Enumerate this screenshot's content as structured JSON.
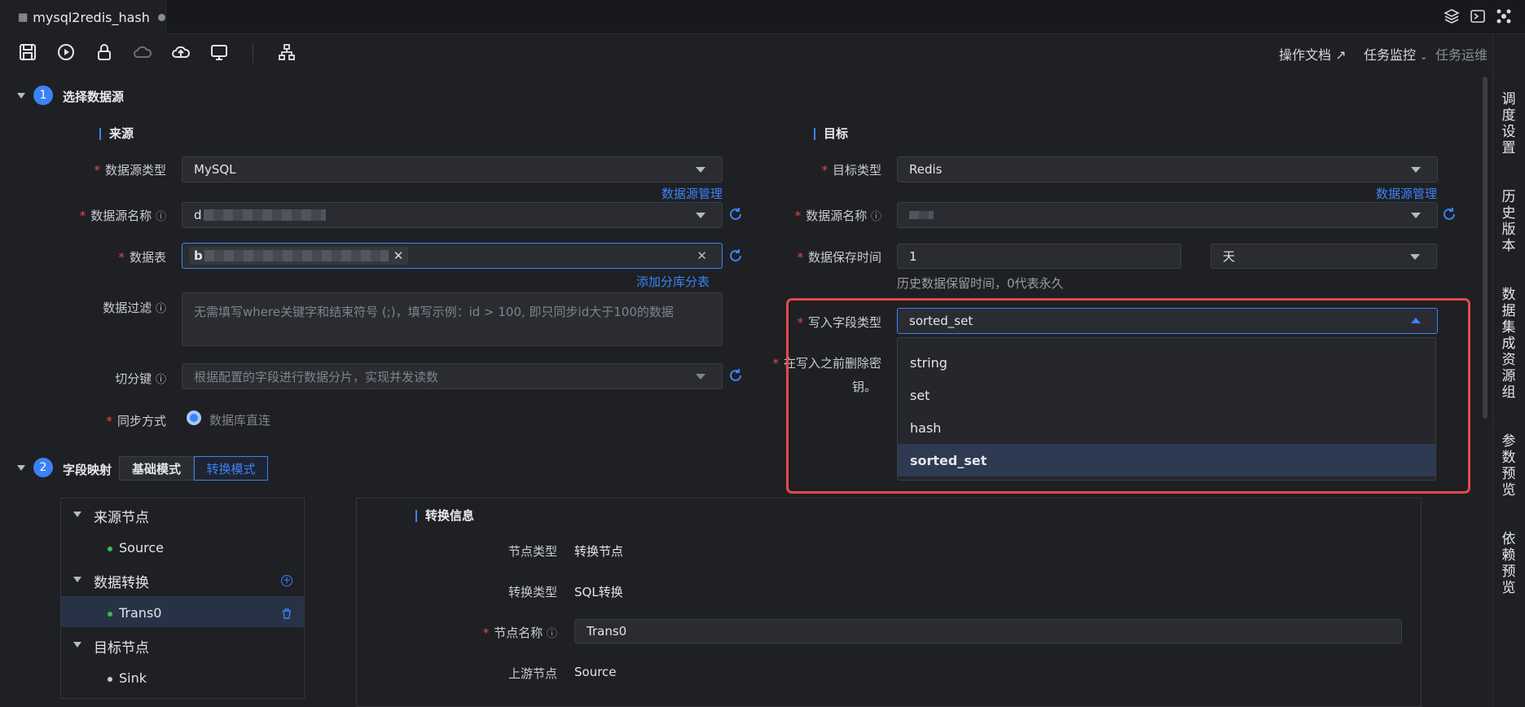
{
  "tab": {
    "title": "mysql2redis_hash"
  },
  "toplinks": {
    "doc": "操作文档 ↗",
    "monitor": "任务监控",
    "ops": "任务运维 ↗"
  },
  "right_sidebar": [
    "调度设置",
    "历史版本",
    "数据集成资源组",
    "参数预览",
    "依赖预览"
  ],
  "step1": {
    "num": "1",
    "title": "选择数据源"
  },
  "source": {
    "title": "来源",
    "type_label": "数据源类型",
    "type_value": "MySQL",
    "manage_link": "数据源管理",
    "name_label": "数据源名称",
    "name_value": "d",
    "table_label": "数据表",
    "table_tag": "b",
    "add_shard_link": "添加分库分表",
    "filter_label": "数据过滤",
    "filter_placeholder": "无需填写where关键字和结束符号 (;)，填写示例：id > 100, 即只同步id大于100的数据",
    "split_label": "切分键",
    "split_placeholder": "根据配置的字段进行数据分片，实现并发读数",
    "sync_label": "同步方式",
    "sync_value": "数据库直连"
  },
  "target": {
    "title": "目标",
    "type_label": "目标类型",
    "type_value": "Redis",
    "manage_link": "数据源管理",
    "name_label": "数据源名称",
    "retention_label": "数据保存时间",
    "retention_value": "1",
    "retention_unit": "天",
    "retention_hint": "历史数据保留时间，0代表永久",
    "field_type_label": "写入字段类型",
    "field_type_value": "sorted_set",
    "delete_label_1": "在写入之前删除密",
    "delete_label_2": "钥。",
    "options": [
      "string",
      "set",
      "hash",
      "sorted_set"
    ],
    "selected_option": "sorted_set"
  },
  "step2": {
    "num": "2",
    "title": "字段映射",
    "mode_basic": "基础模式",
    "mode_transform": "转换模式"
  },
  "tree": {
    "source_head": "来源节点",
    "source_item": "Source",
    "transform_head": "数据转换",
    "transform_item": "Trans0",
    "sink_head": "目标节点",
    "sink_item": "Sink"
  },
  "info": {
    "title": "转换信息",
    "node_type_label": "节点类型",
    "node_type_value": "转换节点",
    "trans_type_label": "转换类型",
    "trans_type_value": "SQL转换",
    "node_name_label": "节点名称",
    "node_name_value": "Trans0",
    "upstream_label": "上游节点",
    "upstream_value": "Source"
  },
  "colors": {
    "accent": "#3b82f6",
    "highlight": "#e5484d",
    "background": "#1f2024"
  }
}
